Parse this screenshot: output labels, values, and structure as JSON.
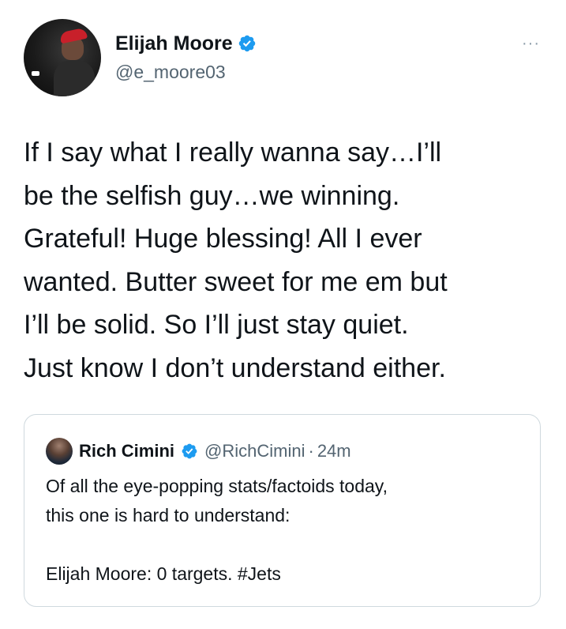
{
  "tweet": {
    "author": {
      "display_name": "Elijah Moore",
      "handle": "@e_moore03",
      "verified": true,
      "avatar_icon": "user-avatar-photo"
    },
    "more_label": "···",
    "text": "If I say what I really wanna say…I’ll\nbe the selfish guy…we winning.\nGrateful! Huge blessing! All I ever\nwanted. Butter sweet for me em but\nI’ll be solid. So I’ll just stay quiet.\nJust know I don’t understand either.",
    "quoted_tweet": {
      "author": {
        "display_name": "Rich Cimini",
        "handle": "@RichCimini",
        "verified": true
      },
      "separator": "·",
      "time": "24m",
      "text": "Of all the eye-popping stats/factoids today,\nthis one is hard to understand:\n\nElijah Moore: 0 targets. #Jets"
    }
  },
  "colors": {
    "verified_blue": "#1d9bf0",
    "secondary_text": "#536471",
    "border": "#cfd9de"
  }
}
